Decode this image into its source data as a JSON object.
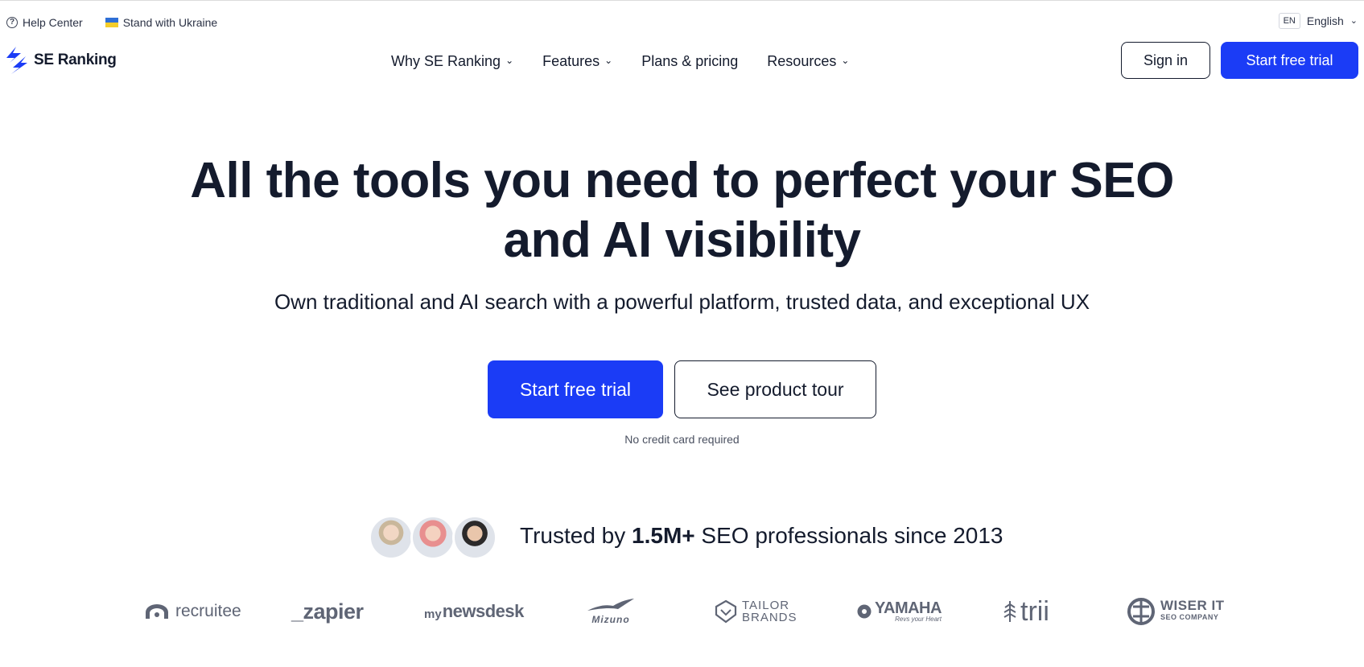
{
  "utility": {
    "help_label": "Help Center",
    "ukraine_label": "Stand with Ukraine",
    "lang_code": "EN",
    "lang_label": "English"
  },
  "header": {
    "logo_text": "SE Ranking",
    "nav": [
      {
        "label": "Why SE Ranking"
      },
      {
        "label": "Features"
      },
      {
        "label": "Plans & pricing"
      },
      {
        "label": "Resources"
      }
    ],
    "signin_label": "Sign in",
    "trial_label": "Start free trial"
  },
  "hero": {
    "title_line1": "All the tools you need to perfect your SEO",
    "title_line2": "and AI visibility",
    "subtitle": "Own traditional and AI search with a powerful platform, trusted data, and exceptional UX",
    "primary_cta": "Start free trial",
    "secondary_cta": "See product tour",
    "note": "No credit card required"
  },
  "trusted": {
    "prefix": "Trusted by ",
    "count": "1.5M+",
    "suffix": " SEO professionals since 2013"
  },
  "logos": {
    "recruitee": "recruitee",
    "zapier": "_zapier",
    "newsdesk_prefix": "my",
    "newsdesk": "newsdesk",
    "mizuno": "Mizuno",
    "tailor_line1": "TAILOR",
    "tailor_line2": "BRANDS",
    "yamaha": "YAMAHA",
    "yamaha_tag": "Revs your Heart",
    "trii": "trii",
    "wiser_line1": "WISER IT",
    "wiser_line2": "SEO COMPANY"
  },
  "colors": {
    "brand_blue": "#1b3cf6",
    "text_dark": "#141b2d",
    "logo_gray": "#5f6575"
  }
}
